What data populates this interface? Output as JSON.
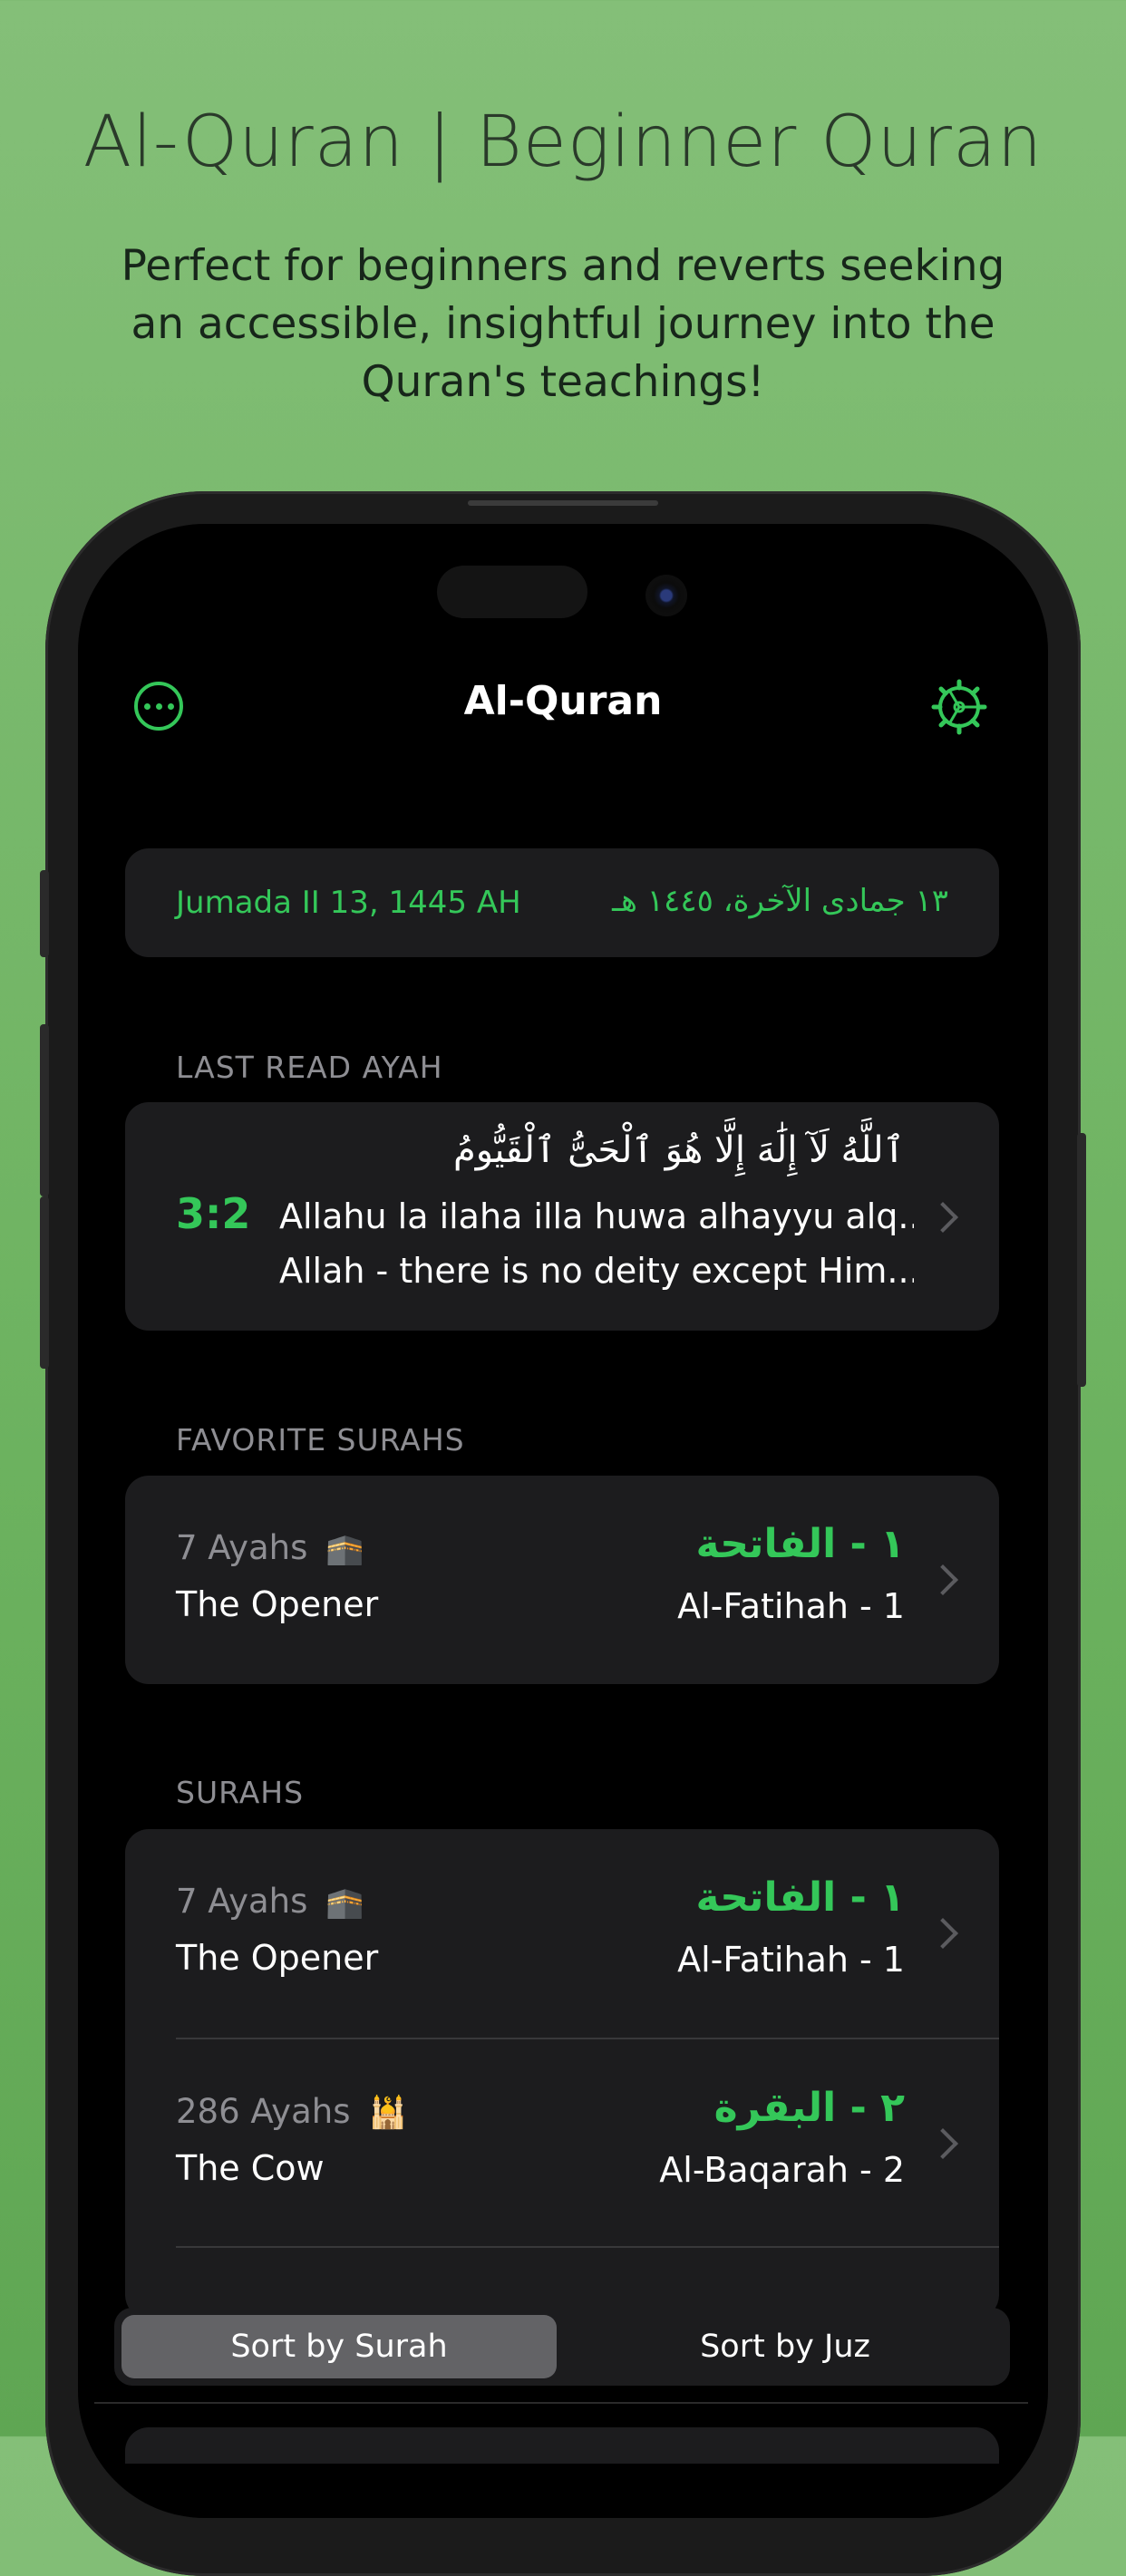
{
  "promo": {
    "title": "Al-Quran | Beginner Quran",
    "subtitle": "Perfect for beginners and reverts seeking an accessible, insightful journey into the Quran's teachings!"
  },
  "nav": {
    "title": "Al-Quran",
    "menu_icon": "ellipsis-circle-icon",
    "settings_icon": "gear-icon"
  },
  "date": {
    "gregorian_hijri": "Jumada II 13, 1445 AH",
    "arabic": "١٣ جمادى الآخرة، ١٤٤٥ هـ"
  },
  "last_read": {
    "header": "LAST READ AYAH",
    "reference": "3:2",
    "arabic": "ٱللَّهُ لَآ إِلَٰهَ إِلَّا هُوَ ٱلْحَىُّ ٱلْقَيُّومُ",
    "transliteration": "Allahu la ilaha illa huwa alhayyu alq...",
    "translation": "Allah - there is no deity except Him..."
  },
  "favorites": {
    "header": "FAVORITE SURAHS",
    "items": [
      {
        "ayahs": "7 Ayahs",
        "emoji": "🕋",
        "english": "The Opener",
        "arabic": "١ - الفاتحة",
        "transliteration": "Al-Fatihah - 1"
      }
    ]
  },
  "surahs": {
    "header": "SURAHS",
    "items": [
      {
        "ayahs": "7 Ayahs",
        "emoji": "🕋",
        "english": "The Opener",
        "arabic": "١ - الفاتحة",
        "transliteration": "Al-Fatihah - 1"
      },
      {
        "ayahs": "286 Ayahs",
        "emoji": "🕌",
        "english": "The Cow",
        "arabic": "٢ - البقرة",
        "transliteration": "Al-Baqarah - 2"
      }
    ]
  },
  "sort": {
    "option_a": "Sort by Surah",
    "option_b": "Sort by Juz",
    "selected": "Sort by Surah"
  },
  "colors": {
    "accent": "#34c759",
    "card": "#1c1c1e",
    "background_gradient_top": "#84bf78"
  }
}
